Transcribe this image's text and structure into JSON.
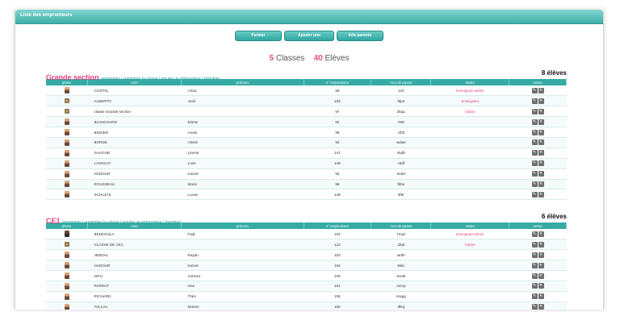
{
  "window": {
    "title": "Liste des emprunteurs"
  },
  "toolbar": {
    "close_label": "Fermer",
    "add_class_label": "Ajouter une classe",
    "parents_label": "Info parents"
  },
  "summary": {
    "classes_count": "5",
    "classes_label": "Classes",
    "students_count": "40",
    "students_label": "Elèves"
  },
  "columns": {
    "photo": "photo",
    "nom": "nom",
    "prenom": "prénom",
    "num": "n° emprunteur",
    "pwd": "mot de passe",
    "statut": "statut",
    "menu": "menu"
  },
  "links": {
    "renommer": "renommer",
    "sep": " | ",
    "supprimer": "supprimer la classe",
    "ajouter": "ajouter un emprunteur",
    "imprimer": "imprimer"
  },
  "icons": {
    "edit": "pencil-icon",
    "delete": "close-icon"
  },
  "sections": [
    {
      "title": "Grande section",
      "count": "8 élèves",
      "rows": [
        {
          "nom": "COSTAL",
          "prenom": "Alicia",
          "num": "98",
          "pwd": "zsrf",
          "statut": "Enseignant admin",
          "photo": "person"
        },
        {
          "nom": "ALBERTO",
          "prenom": "José",
          "num": "163",
          "pwd": "fdpe",
          "statut": "Enseignant",
          "photo": "group"
        },
        {
          "nom": "classe Grande section",
          "prenom": "",
          "num": "97",
          "pwd": "2bqu",
          "statut": "Classe",
          "photo": "group"
        },
        {
          "nom": "BLANCHARD",
          "prenom": "Eloïse",
          "num": "94",
          "pwd": "r9rk",
          "statut": "",
          "photo": "person"
        },
        {
          "nom": "BODIER",
          "prenom": "Anaïs",
          "num": "95",
          "pwd": "clf3l",
          "statut": "",
          "photo": "person"
        },
        {
          "nom": "BORDE",
          "prenom": "Alexis",
          "num": "92",
          "pwd": "wdwe",
          "statut": "",
          "photo": "person"
        },
        {
          "nom": "GAUCHE",
          "prenom": "Léonie",
          "num": "147",
          "pwd": "45db",
          "statut": "",
          "photo": "person"
        },
        {
          "nom": "LAVOCAT",
          "prenom": "Loris",
          "num": "148",
          "pwd": "c8df",
          "statut": "",
          "photo": "person"
        },
        {
          "nom": "NADOUR",
          "prenom": "Kamel",
          "num": "93",
          "pwd": "5n9d",
          "statut": "",
          "photo": "person"
        },
        {
          "nom": "ROUSSEAU",
          "prenom": "Marie",
          "num": "96",
          "pwd": "fbbe",
          "statut": "",
          "photo": "person"
        },
        {
          "nom": "SCHULTZ",
          "prenom": "Lucas",
          "num": "149",
          "pwd": "5f6r",
          "statut": "",
          "photo": "person"
        }
      ]
    },
    {
      "title": "CE1",
      "count": "6 élèves",
      "rows": [
        {
          "nom": "BENKOULA",
          "prenom": "Fadi",
          "num": "102",
          "pwd": "7mpz",
          "statut": "Enseignant admin",
          "photo": "dark"
        },
        {
          "nom": "CLASSE DE CE1",
          "prenom": "",
          "num": "123",
          "pwd": "d2pt",
          "statut": "Classe",
          "photo": "group"
        },
        {
          "nom": "JEDDAL",
          "prenom": "Rayan",
          "num": "103",
          "pwd": "wrdh",
          "statut": "",
          "photo": "person"
        },
        {
          "nom": "NADOUR",
          "prenom": "Kamel",
          "num": "104",
          "pwd": "35kc",
          "statut": "",
          "photo": "person"
        },
        {
          "nom": "NITU",
          "prenom": "Antonio",
          "num": "105",
          "pwd": "sm36",
          "statut": "",
          "photo": "person"
        },
        {
          "nom": "PARROT",
          "prenom": "Noa",
          "num": "151",
          "pwd": "mecp",
          "statut": "",
          "photo": "person"
        },
        {
          "nom": "RICHARD",
          "prenom": "Théo",
          "num": "106",
          "pwd": "mwgq",
          "statut": "",
          "photo": "person"
        },
        {
          "nom": "TALLAU",
          "prenom": "Manon",
          "num": "150",
          "pwd": "dfeq",
          "statut": "",
          "photo": "person"
        }
      ]
    }
  ]
}
